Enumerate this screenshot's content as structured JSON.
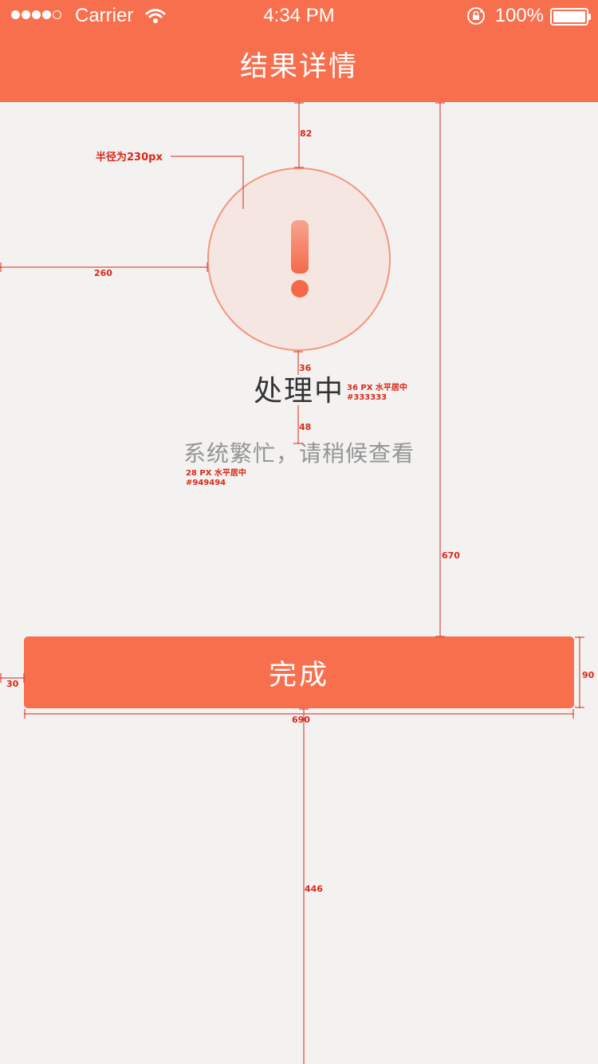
{
  "status_bar": {
    "carrier": "Carrier",
    "time": "4:34 PM",
    "battery": "100%",
    "signal_bars_filled": 4,
    "signal_bars_total": 5
  },
  "nav": {
    "title": "结果详情"
  },
  "result": {
    "icon": "exclamation-icon",
    "title": "处理中",
    "description": "系统繁忙，请稍候查看"
  },
  "actions": {
    "done_label": "完成"
  },
  "spec_annotations": {
    "radius_note": "半径为230px",
    "top_gap": "82",
    "left_gap": "260",
    "icon_title_gap": "36",
    "title_desc_gap": "48",
    "title_spec_size": "36 PX  水平居中",
    "title_spec_color": "#333333",
    "desc_spec_size": "28 PX  水平居中",
    "desc_spec_color": "#949494",
    "button_top_gap": "670",
    "button_left_gap": "30",
    "button_height": "90",
    "button_width": "690",
    "bottom_gap": "446"
  },
  "colors": {
    "brand": "#f86f4e",
    "background": "#f3f2f0",
    "title_text": "#333333",
    "desc_text": "#949494",
    "annotation": "#d9281a"
  }
}
